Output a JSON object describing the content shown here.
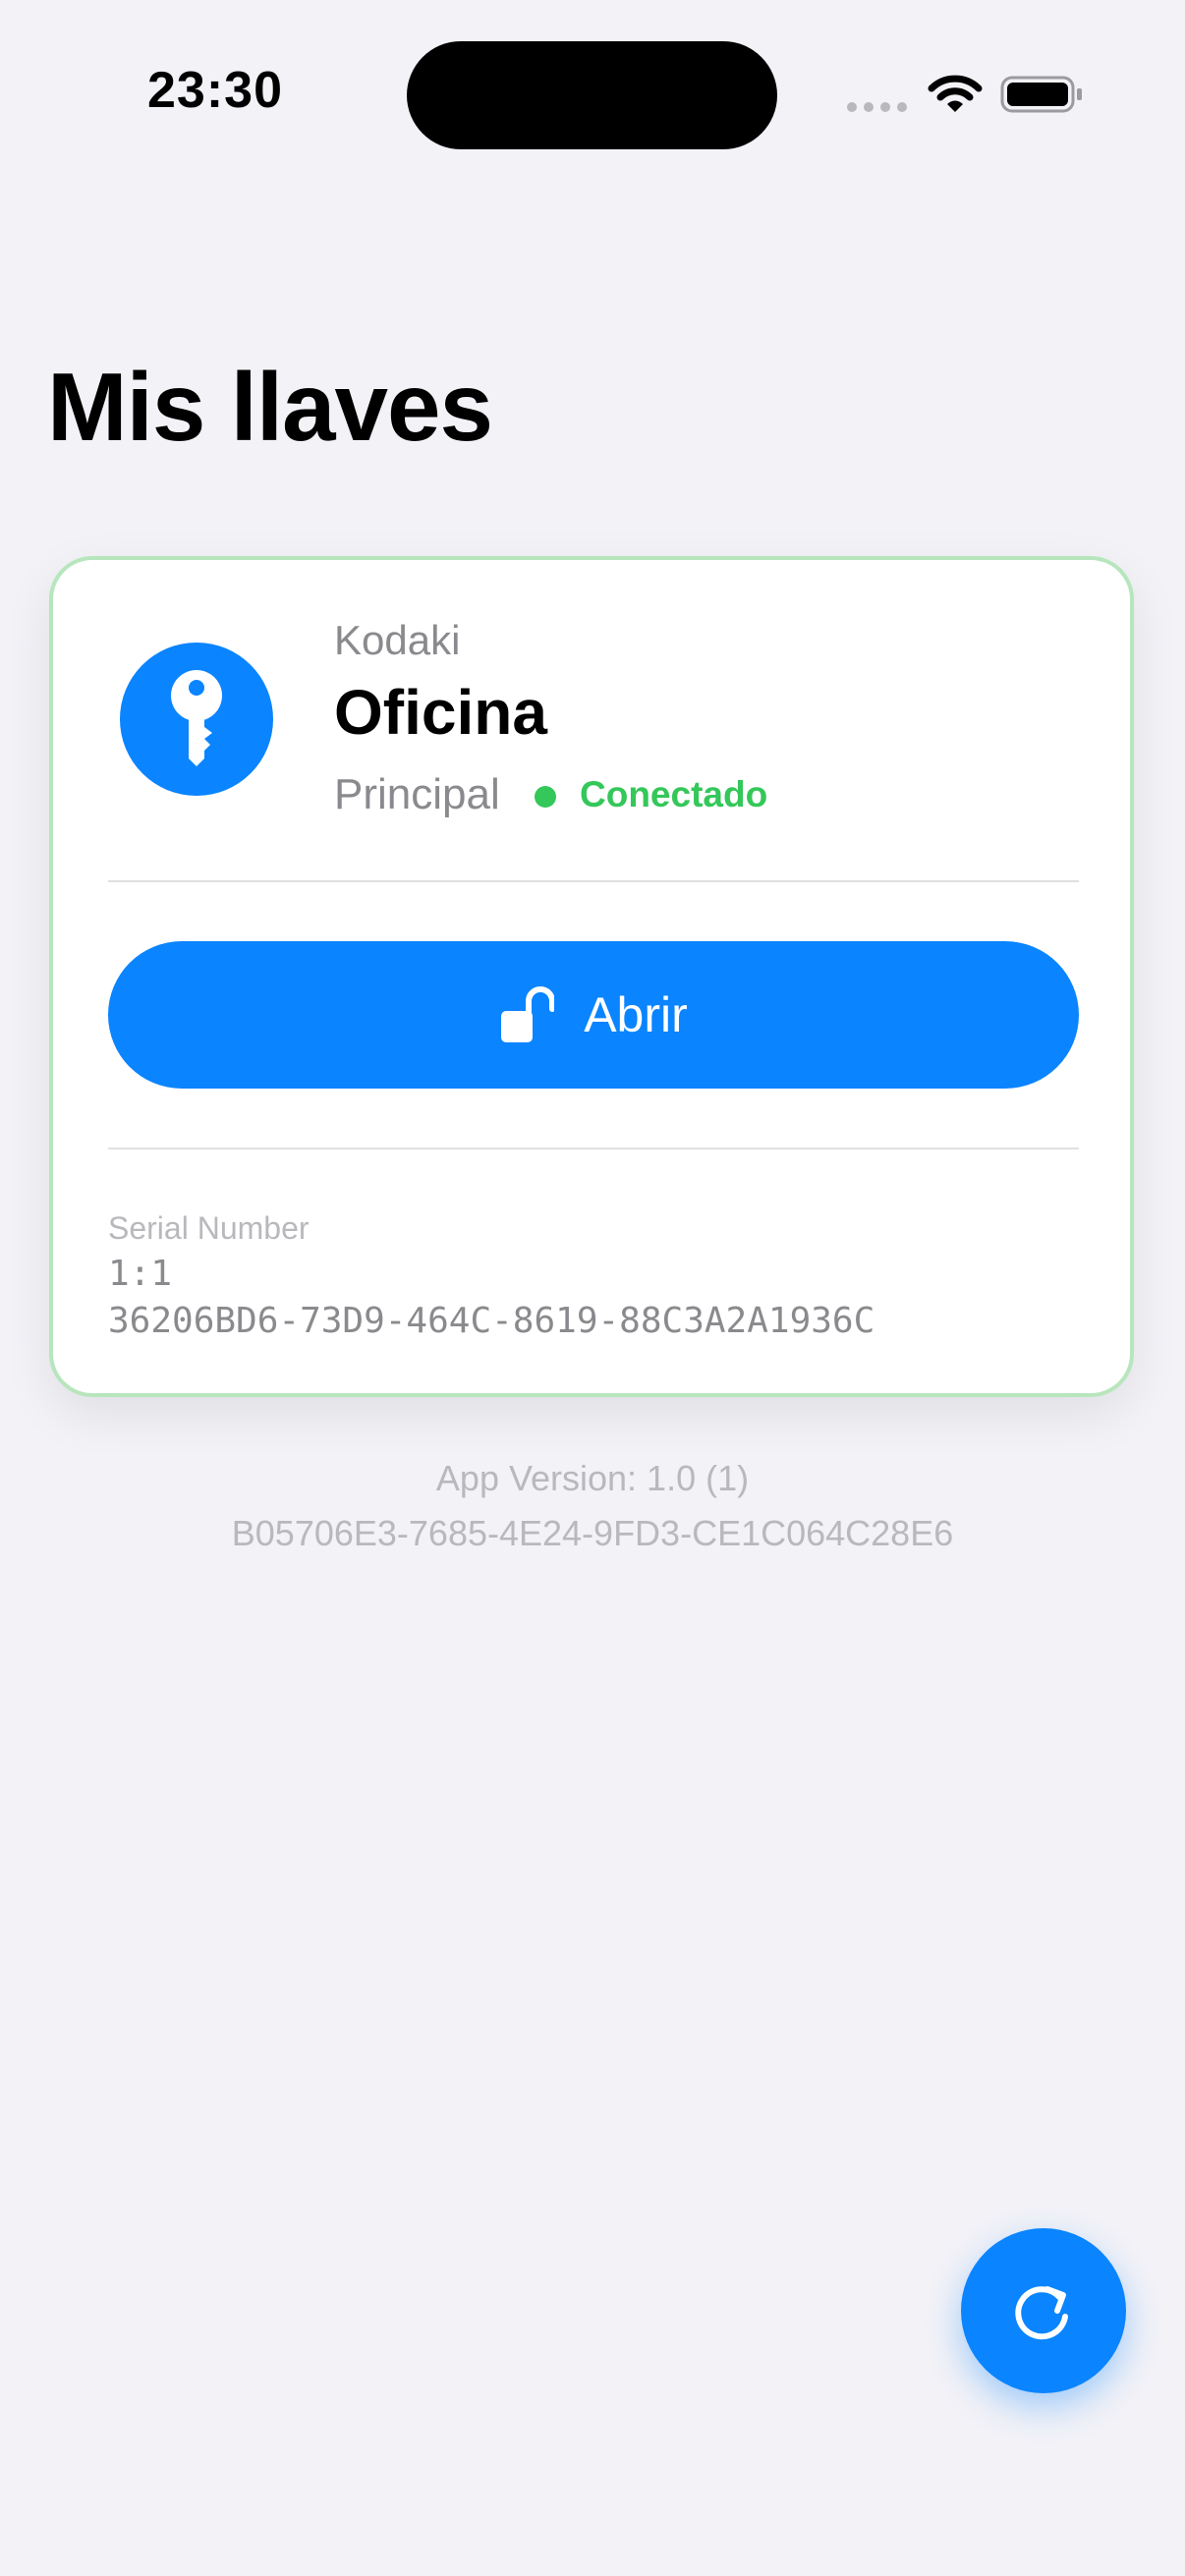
{
  "status_bar": {
    "time": "23:30",
    "icons": [
      "cellular-signal-icon",
      "wifi-icon",
      "battery-icon"
    ]
  },
  "header": {
    "title": "Mis llaves"
  },
  "key_card": {
    "icon": "key-icon",
    "brand": "Kodaki",
    "name": "Oficina",
    "role": "Principal",
    "status": "Conectado",
    "open_button": {
      "icon": "unlock-icon",
      "label": "Abrir"
    },
    "serial_label": "Serial Number",
    "serial_lines": [
      "1:1",
      "36206BD6-73D9-464C-8619-88C3A2A1936C"
    ]
  },
  "footer": {
    "app_version": "App Version:  1.0 (1)",
    "device_id": "B05706E3-7685-4E24-9FD3-CE1C064C28E6"
  },
  "fab": {
    "icon": "refresh-icon"
  },
  "colors": {
    "accent": "#0a84ff",
    "connected": "#34c759",
    "card_border": "#b7e6bc",
    "background": "#f2f2f7"
  }
}
